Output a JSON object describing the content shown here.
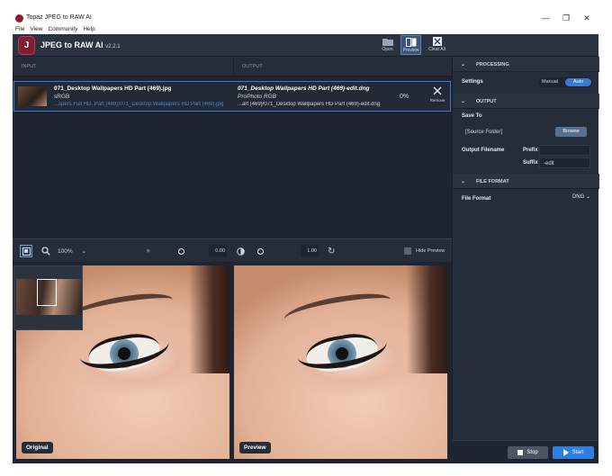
{
  "window": {
    "title": "Topaz JPEG to RAW AI",
    "minimize": "—",
    "maximize": "❐",
    "close": "✕"
  },
  "menu": [
    "File",
    "View",
    "Community",
    "Help"
  ],
  "header": {
    "logo_letter": "J",
    "app_name": "JPEG to RAW AI",
    "version": "v2.2.1",
    "open_label": "Open",
    "preview_label": "Preview",
    "clear_all_label": "Clear All"
  },
  "list": {
    "input_header": "INPUT",
    "output_header": "OUTPUT",
    "file": {
      "name": "071_Desktop Wallpapers  HD Part (469).jpg",
      "colorspace": "sRGB",
      "path": "...spers Full HD. Part (469)/071_Desktop Wallpapers  HD Part (469).jpg",
      "output_name": "071_Desktop Wallpapers  HD Part (469)-edit.dng",
      "output_profile": "ProPhoto RGB",
      "output_path": "...art (469)/071_Desktop Wallpapers  HD Part (469)-edit.dng",
      "progress": "0%",
      "remove_label": "Remove"
    }
  },
  "toolbar": {
    "zoom": "100%",
    "exposure_value": "0.00",
    "contrast_value": "1.00",
    "hide_preview": "Hide Preview"
  },
  "compare": {
    "left_label": "Original",
    "right_label": "Preview"
  },
  "panel": {
    "processing": {
      "title": "PROCESSING",
      "settings_label": "Settings",
      "manual": "Manual",
      "auto": "Auto"
    },
    "output": {
      "title": "OUTPUT",
      "save_to": "Save To",
      "folder": "[Source Folder]",
      "browse": "Browse",
      "filename_label": "Output Filename",
      "prefix_label": "Prefix",
      "prefix_value": "",
      "suffix_label": "Suffix",
      "suffix_value": "-edit"
    },
    "format": {
      "title": "FILE FORMAT",
      "label": "File Format",
      "value": "DNG"
    }
  },
  "actions": {
    "stop": "Stop",
    "start": "Start"
  },
  "colors": {
    "accent": "#3a7bd0",
    "start": "#2f7fe0",
    "bg": "#1e2430",
    "panel": "#262d3a",
    "logo": "#7d1f2f"
  }
}
